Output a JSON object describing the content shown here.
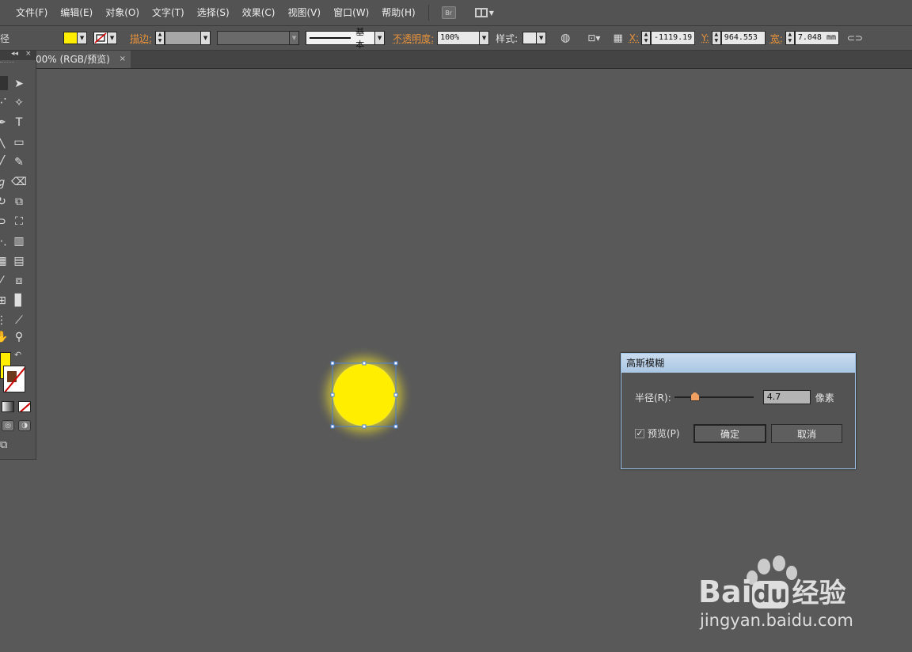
{
  "menubar": {
    "items": [
      "文件(F)",
      "编辑(E)",
      "对象(O)",
      "文字(T)",
      "选择(S)",
      "效果(C)",
      "视图(V)",
      "窗口(W)",
      "帮助(H)"
    ],
    "bridge_label": "Br"
  },
  "controlbar": {
    "left_label": "径",
    "fill_color": "#ffee00",
    "stroke_label": "描边:",
    "stroke_profile": "基本",
    "opacity_label": "不透明度:",
    "opacity_value": "100%",
    "style_label": "样式:",
    "x_label": "X:",
    "x_value": "-1119.19",
    "y_label": "Y:",
    "y_value": "964.553",
    "w_label": "宽:",
    "w_value": "7.048 mm"
  },
  "document_tab": {
    "label": "00% (RGB/预览)",
    "close": "×"
  },
  "toolpanel": {
    "collapse": "◂◂",
    "close": "×",
    "type_tool": "T"
  },
  "dialog": {
    "title": "高斯模糊",
    "radius_label": "半径(R):",
    "radius_value": "4.7",
    "unit": "像素",
    "preview_label": "预览(P)",
    "preview_checked": "✓",
    "ok_label": "确定",
    "cancel_label": "取消"
  },
  "canvas": {
    "circle_color": "#ffee00",
    "glow_color": "#d9cf3a",
    "selection_color": "#4a7fd8"
  },
  "watermark": {
    "brand": "Bai",
    "brand2": "du",
    "suffix": "经验",
    "url": "jingyan.baidu.com"
  }
}
